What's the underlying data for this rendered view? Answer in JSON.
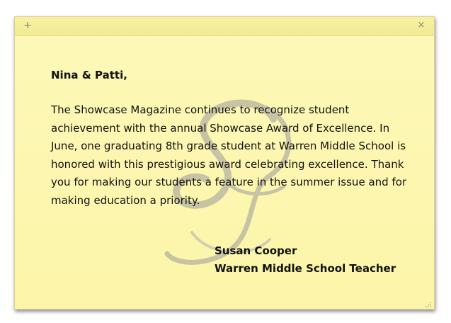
{
  "note": {
    "add_label": "+",
    "close_label": "×",
    "greeting": "Nina & Patti,",
    "message": "The Showcase Magazine continues to recognize student achievement with the annual Showcase Award of Excellence. In June, one graduating 8th grade student at Warren Middle School is honored with this prestigious award celebrating excellence. Thank you for making our students a feature in the summer issue and for making education a priority.",
    "signature_name": "Susan Cooper",
    "signature_title": "Warren Middle School Teacher"
  },
  "colors": {
    "note_background": "#fcf5a9",
    "titlebar": "#f1ea93",
    "watermark": "#9c9c9c",
    "text": "#111111"
  },
  "icons": {
    "add": "plus-icon",
    "close": "close-icon",
    "watermark": "script-s-monogram-icon",
    "resize": "resize-grip-icon"
  }
}
